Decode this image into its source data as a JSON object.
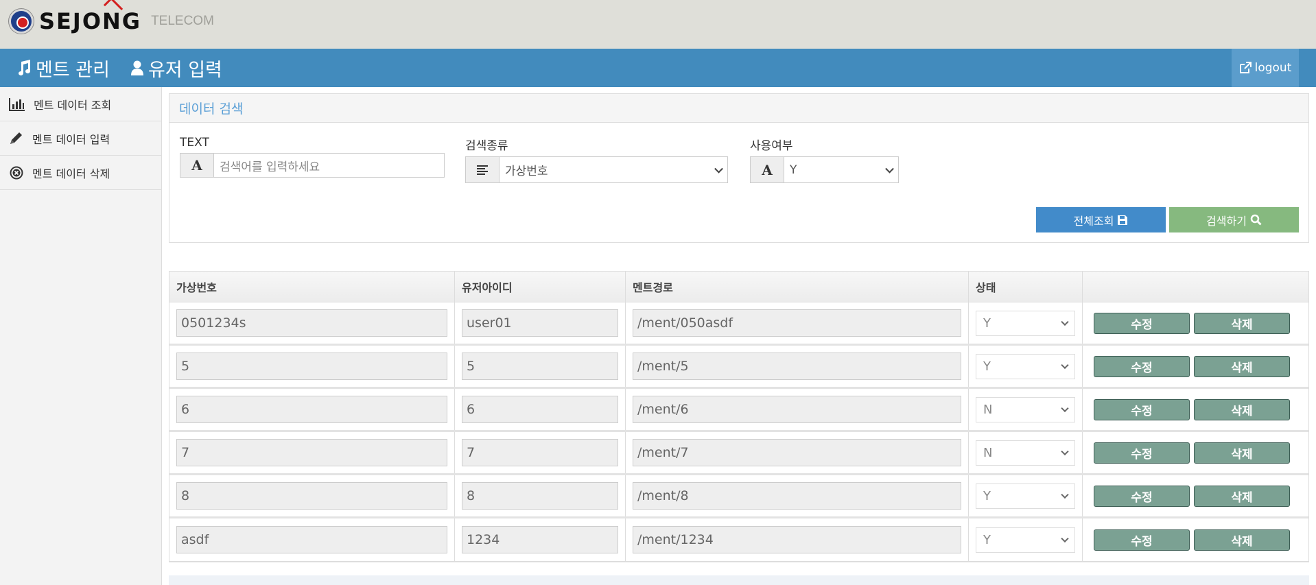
{
  "brand": {
    "name": "SEJONG",
    "sub": "TELECOM"
  },
  "nav": {
    "items": [
      {
        "label": "멘트 관리",
        "icon": "music-icon"
      },
      {
        "label": "유저 입력",
        "icon": "user-icon"
      }
    ],
    "logout": "logout"
  },
  "sidebar": {
    "items": [
      {
        "label": "멘트 데이터 조회",
        "icon": "bar-chart-icon"
      },
      {
        "label": "멘트 데이터 입력",
        "icon": "pencil-icon"
      },
      {
        "label": "멘트 데이터 삭제",
        "icon": "remove-circle-icon"
      }
    ]
  },
  "search": {
    "title": "데이터 검색",
    "text_label": "TEXT",
    "text_placeholder": "검색어를 입력하세요",
    "type_label": "검색종류",
    "type_value": "가상번호",
    "use_label": "사용여부",
    "use_value": "Y",
    "all_button": "전체조회",
    "search_button": "검색하기"
  },
  "table": {
    "headers": [
      "가상번호",
      "유저아이디",
      "멘트경로",
      "상태",
      ""
    ],
    "edit_label": "수정",
    "delete_label": "삭제",
    "rows": [
      {
        "vnum": "0501234s",
        "user": "user01",
        "path": "/ment/050asdf",
        "status": "Y"
      },
      {
        "vnum": "5",
        "user": "5",
        "path": "/ment/5",
        "status": "Y"
      },
      {
        "vnum": "6",
        "user": "6",
        "path": "/ment/6",
        "status": "N"
      },
      {
        "vnum": "7",
        "user": "7",
        "path": "/ment/7",
        "status": "N"
      },
      {
        "vnum": "8",
        "user": "8",
        "path": "/ment/8",
        "status": "Y"
      },
      {
        "vnum": "asdf",
        "user": "1234",
        "path": "/ment/1234",
        "status": "Y"
      }
    ]
  },
  "colors": {
    "nav": "#428bbd",
    "primary": "#428bca",
    "success": "#86b97f",
    "action": "#7ba193"
  }
}
